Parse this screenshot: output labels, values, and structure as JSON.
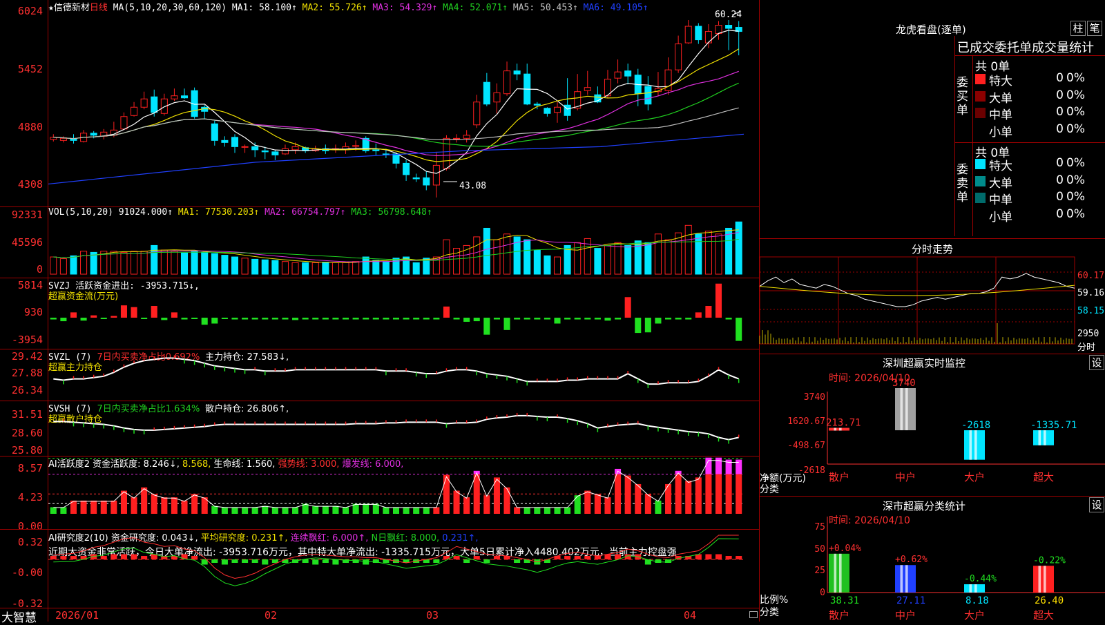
{
  "colors": {
    "up": "#ff2020",
    "down": "#00e5ff",
    "ma1": "#ffffff",
    "ma2": "#f0e000",
    "ma3": "#e030e0",
    "ma4": "#20d020",
    "ma5": "#c0c0c0",
    "ma6": "#2040ff",
    "grid": "#a00000"
  },
  "header": {
    "star": "★",
    "stock": "信德新材",
    "period": "日线",
    "ma_label": "MA(5,10,20,30,60,120)",
    "ma1": "MA1: 58.100↑",
    "ma2": "MA2: 55.726↑",
    "ma3": "MA3: 54.329↑",
    "ma4": "MA4: 52.071↑",
    "ma5": "MA5: 50.453↑",
    "ma6": "MA6: 49.105↑"
  },
  "price_axis": [
    "6024",
    "5452",
    "4880",
    "4308"
  ],
  "price_annot": {
    "high": "60.24",
    "low": "43.08"
  },
  "vol": {
    "label": "VOL(5,10,20)",
    "value": "91024.000↑",
    "ma1": "MA1: 77530.203↑",
    "ma2": "MA2: 66754.797↑",
    "ma3": "MA3: 56798.648↑",
    "axis": [
      "92331",
      "45596",
      "0"
    ]
  },
  "svzj": {
    "label": "SVZJ  活跃资金进出: -3953.715↓,",
    "sub": "超赢资金流(万元)",
    "axis": [
      "5814",
      "930",
      "-3954"
    ]
  },
  "svzl": {
    "label": "SVZL (7)",
    "ratio": "7日内买卖净占比0.692%",
    "hold": "主力持仓: 27.583↓,",
    "sub": "超赢主力持仓",
    "axis": [
      "29.42",
      "27.88",
      "26.34"
    ]
  },
  "svsh": {
    "label": "SVSH (7)",
    "ratio": "7日内买卖净占比1.634%",
    "hold": "散户持仓: 26.806↑,",
    "sub": "超赢散户持仓",
    "axis": [
      "31.51",
      "28.60",
      "25.80"
    ]
  },
  "ai_active": {
    "label": "AI活跃度2",
    "v1": "资金活跃度: 8.246↓,",
    "v2": "8.568,",
    "v3": "生命线: 1.560,",
    "v4": "强势线: 3.000,",
    "v5": "爆发线: 6.000,",
    "axis": [
      "8.57",
      "4.23",
      "0.00"
    ]
  },
  "ai_research": {
    "label": "AI研究度2(10)",
    "v1": "资金研究度: 0.043↓,",
    "v2": "平均研究度: 0.231↑,",
    "v3": "连续飘红: 6.000↑,",
    "v4": "N日飘红: 8.000,",
    "v5": "0.231↑,",
    "summary": "近期大资金非常活跃，今日大单净流出: -3953.716万元，其中特大单净流出: -1335.715万元，大单5日累计净入4480.402万元，当前主力控盘强",
    "axis": [
      "0.32",
      "-0.00",
      "-0.32"
    ]
  },
  "date_axis": [
    "2026/01",
    "02",
    "03",
    "04"
  ],
  "brand": "大智慧",
  "lhb": {
    "title": "龙虎看盘(逐单)",
    "btn1": "柱",
    "btn2": "笔",
    "tabs": "已成交委托单成交量统计",
    "buy_title": "委买单",
    "sell_title": "委卖单",
    "buy_total": "共 0单",
    "sell_total": "共 0单",
    "buy_rows": [
      {
        "name": "特大",
        "n": "0",
        "p": "0%",
        "c": "#ff2020"
      },
      {
        "name": "大单",
        "n": "0",
        "p": "0%",
        "c": "#8b0000"
      },
      {
        "name": "中单",
        "n": "0",
        "p": "0%",
        "c": "#6b0000"
      },
      {
        "name": "小单",
        "n": "0",
        "p": "0%",
        "c": "#000000"
      }
    ],
    "sell_rows": [
      {
        "name": "特大",
        "n": "0",
        "p": "0%",
        "c": "#00e5ff"
      },
      {
        "name": "大单",
        "n": "0",
        "p": "0%",
        "c": "#008b8b"
      },
      {
        "name": "中单",
        "n": "0",
        "p": "0%",
        "c": "#006b6b"
      },
      {
        "name": "小单",
        "n": "0",
        "p": "0%",
        "c": "#000000"
      }
    ]
  },
  "fenshi": {
    "title": "分时走势",
    "axis": [
      "60.17",
      "59.16",
      "58.15"
    ],
    "vol_axis": "2950",
    "vol_unit": "分时"
  },
  "monitor": {
    "title": "深圳超赢实时监控",
    "btn": "设",
    "time": "时间: 2026/04/10",
    "axis": [
      "3740",
      "1620.67",
      "-498.67",
      "-2618"
    ],
    "unit": "净额(万元)",
    "cat_label": "分类",
    "bars": [
      {
        "name": "散户",
        "v": "213.71"
      },
      {
        "name": "中户",
        "v": "3740"
      },
      {
        "name": "大户",
        "v": "-2618"
      },
      {
        "name": "超大",
        "v": "-1335.71"
      }
    ]
  },
  "stat": {
    "title": "深市超赢分类统计",
    "btn": "设",
    "time": "时间: 2026/04/10",
    "axis": [
      "75",
      "50",
      "25",
      "0"
    ],
    "unit": "比例%",
    "cat_label": "分类",
    "bars": [
      {
        "name": "散户",
        "v": "38.31",
        "chg": "+0.04%"
      },
      {
        "name": "中户",
        "v": "27.11",
        "chg": "+0.62%"
      },
      {
        "name": "大户",
        "v": "8.18",
        "chg": "-0.44%"
      },
      {
        "name": "超大",
        "v": "26.40",
        "chg": "-0.22%"
      }
    ]
  },
  "chart_data": {
    "type": "candlestick",
    "candles": [
      [
        48.7,
        48.9,
        49.2,
        48.5
      ],
      [
        48.6,
        48.8,
        49.0,
        48.4
      ],
      [
        48.8,
        48.6,
        49.2,
        48.3
      ],
      [
        48.5,
        49.3,
        49.6,
        48.4
      ],
      [
        49.3,
        49.1,
        49.5,
        48.8
      ],
      [
        49.0,
        49.4,
        49.7,
        48.7
      ],
      [
        49.1,
        49.6,
        50.4,
        48.9
      ],
      [
        49.7,
        50.9,
        51.3,
        49.6
      ],
      [
        51.0,
        51.8,
        52.3,
        50.9
      ],
      [
        51.8,
        52.6,
        53.3,
        51.6
      ],
      [
        52.8,
        51.3,
        53.5,
        50.9
      ],
      [
        51.2,
        52.6,
        53.1,
        51.0
      ],
      [
        52.6,
        52.9,
        53.6,
        52.4
      ],
      [
        52.9,
        52.7,
        53.6,
        52.6
      ],
      [
        53.4,
        50.9,
        53.7,
        50.7
      ],
      [
        51.8,
        51.4,
        52.0,
        50.7
      ],
      [
        50.2,
        48.6,
        50.5,
        48.1
      ],
      [
        48.6,
        48.4,
        49.0,
        48.0
      ],
      [
        48.9,
        48.0,
        49.2,
        47.4
      ],
      [
        48.0,
        48.0,
        48.2,
        47.4
      ],
      [
        48.0,
        47.7,
        48.4,
        47.0
      ],
      [
        47.6,
        47.5,
        48.0,
        46.8
      ],
      [
        47.5,
        47.2,
        47.7,
        46.7
      ],
      [
        47.3,
        47.8,
        48.2,
        47.2
      ],
      [
        47.7,
        48.0,
        48.4,
        47.3
      ],
      [
        47.9,
        47.6,
        48.0,
        47.4
      ],
      [
        47.6,
        47.8,
        48.1,
        47.5
      ],
      [
        47.8,
        47.6,
        48.2,
        47.3
      ],
      [
        47.7,
        47.8,
        48.2,
        47.4
      ],
      [
        47.7,
        48.0,
        48.4,
        47.3
      ],
      [
        48.1,
        48.1,
        48.6,
        47.6
      ],
      [
        48.8,
        47.6,
        49.0,
        47.4
      ],
      [
        47.7,
        47.6,
        48.3,
        47.2
      ],
      [
        47.3,
        47.2,
        47.8,
        46.9
      ],
      [
        47.3,
        46.4,
        47.4,
        45.9
      ],
      [
        46.4,
        45.3,
        46.7,
        44.7
      ],
      [
        45.0,
        44.9,
        45.4,
        44.6
      ],
      [
        45.0,
        44.3,
        45.6,
        43.8
      ],
      [
        44.3,
        46.2,
        47.5,
        43.1
      ],
      [
        45.9,
        48.8,
        49.1,
        45.7
      ],
      [
        48.8,
        48.8,
        49.2,
        48.4
      ],
      [
        48.8,
        49.1,
        49.6,
        48.4
      ],
      [
        50.1,
        52.3,
        53.0,
        49.8
      ],
      [
        54.2,
        52.1,
        55.1,
        51.9
      ],
      [
        52.3,
        53.2,
        54.1,
        51.2
      ],
      [
        53.1,
        55.3,
        56.2,
        52.9
      ],
      [
        55.3,
        55.0,
        56.0,
        54.4
      ],
      [
        55.0,
        52.1,
        56.0,
        52.0
      ],
      [
        52.1,
        52.0,
        52.3,
        51.6
      ],
      [
        51.7,
        51.2,
        51.8,
        50.9
      ],
      [
        51.3,
        51.8,
        52.3,
        50.3
      ],
      [
        52.0,
        51.0,
        54.6,
        50.5
      ],
      [
        51.7,
        53.3,
        55.0,
        51.5
      ],
      [
        53.4,
        53.7,
        55.3,
        53.0
      ],
      [
        53.0,
        52.3,
        53.8,
        52.2
      ],
      [
        52.9,
        54.5,
        55.4,
        52.7
      ],
      [
        54.6,
        55.2,
        56.4,
        54.1
      ],
      [
        55.3,
        54.8,
        56.0,
        54.0
      ],
      [
        54.9,
        53.1,
        55.5,
        51.9
      ],
      [
        53.8,
        52.1,
        54.8,
        51.5
      ],
      [
        53.3,
        53.6,
        55.2,
        52.9
      ],
      [
        53.4,
        55.4,
        56.6,
        53.0
      ],
      [
        55.4,
        57.9,
        58.7,
        55.1
      ],
      [
        58.0,
        59.6,
        60.2,
        57.9
      ],
      [
        59.6,
        58.3,
        59.9,
        57.9
      ],
      [
        58.0,
        59.1,
        59.8,
        57.5
      ],
      [
        58.9,
        59.7,
        60.1,
        58.3
      ],
      [
        59.7,
        59.4,
        60.2,
        57.3
      ],
      [
        59.5,
        59.1,
        60.1,
        56.8
      ]
    ]
  }
}
